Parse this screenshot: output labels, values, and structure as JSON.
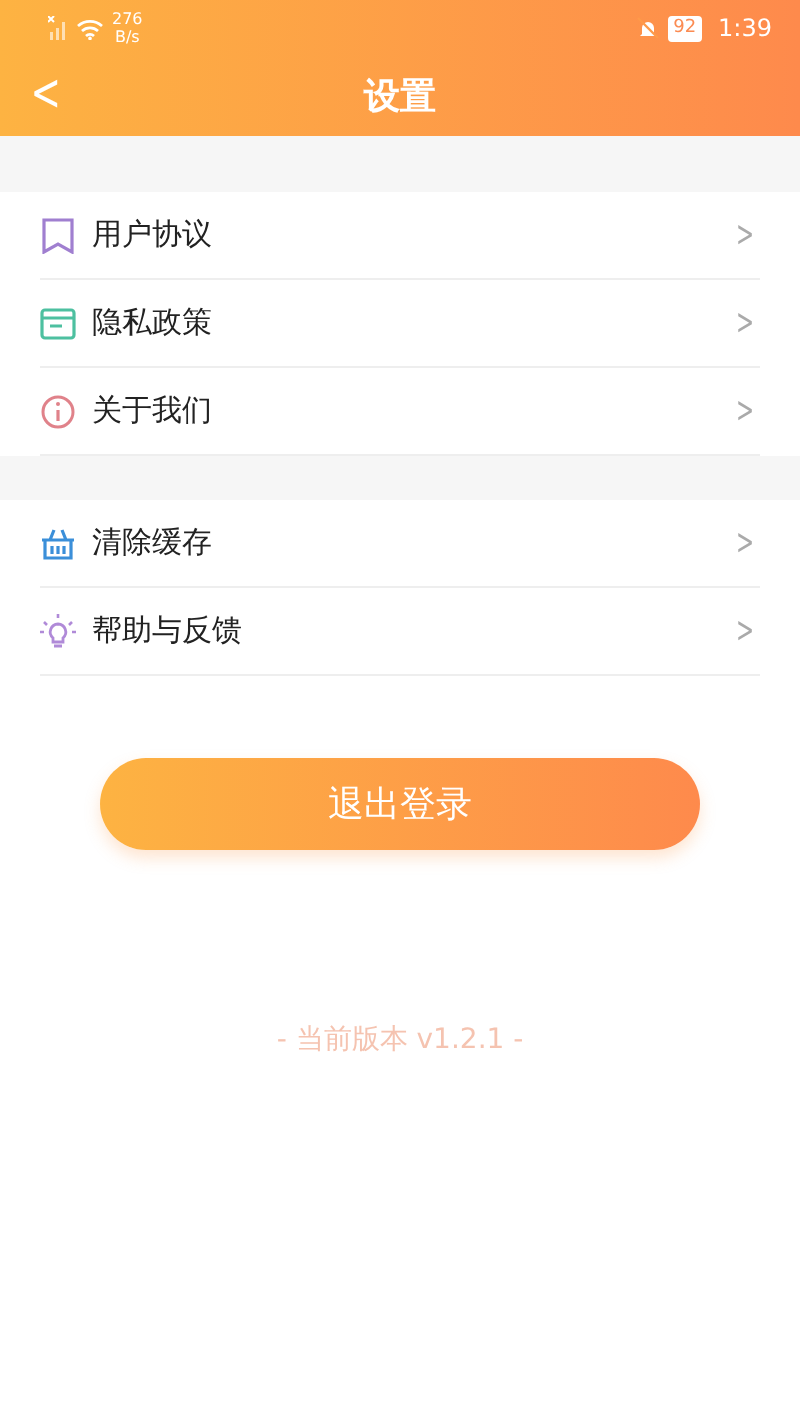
{
  "status_bar": {
    "speed": "276",
    "speed_unit": "B/s",
    "battery": "92",
    "time": "1:39"
  },
  "header": {
    "back": "<",
    "title": "设置"
  },
  "groups": [
    {
      "items": [
        {
          "label": "用户协议",
          "chevron": ">"
        },
        {
          "label": "隐私政策",
          "chevron": ">"
        },
        {
          "label": "关于我们",
          "chevron": ">"
        }
      ]
    },
    {
      "items": [
        {
          "label": "清除缓存",
          "chevron": ">"
        },
        {
          "label": "帮助与反馈",
          "chevron": ">"
        }
      ]
    }
  ],
  "logout_button": "退出登录",
  "version": "- 当前版本 v1.2.1 -"
}
